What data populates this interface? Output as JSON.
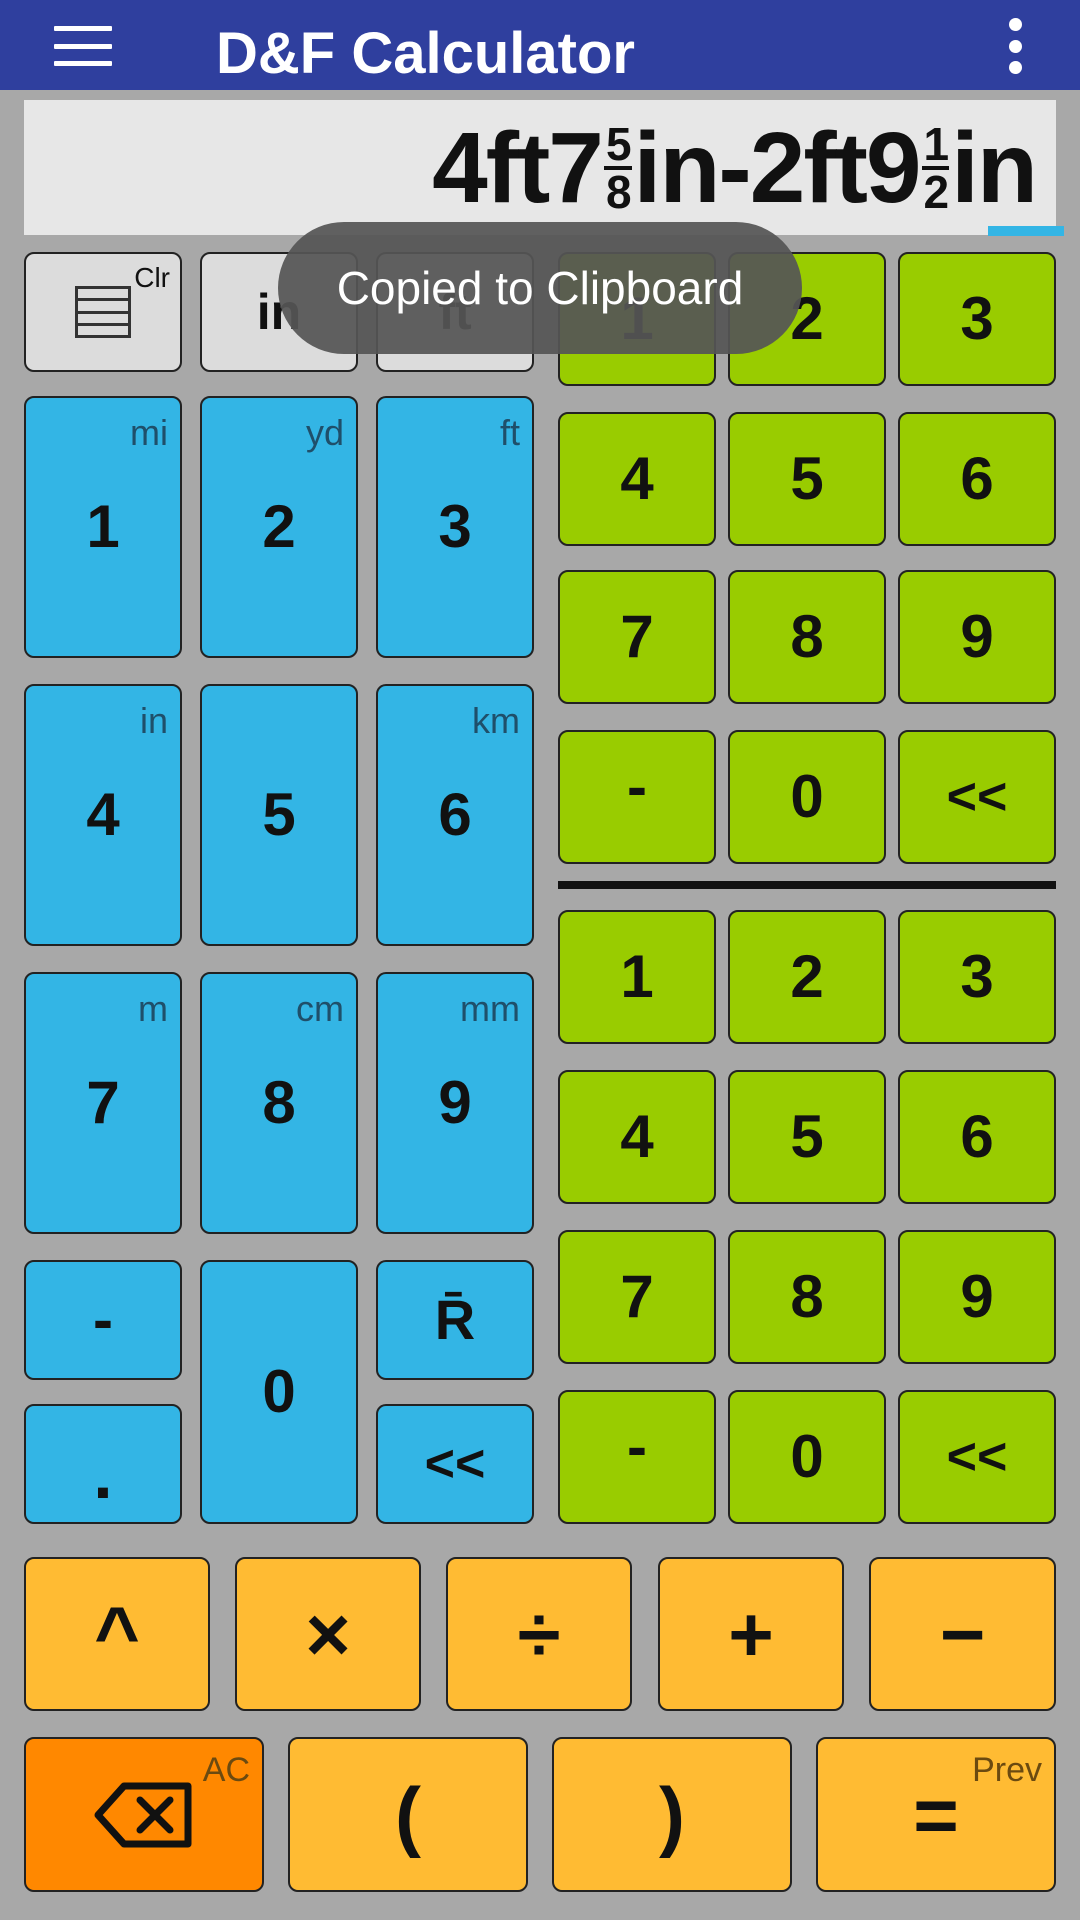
{
  "app": {
    "title": "D&F Calculator"
  },
  "display": {
    "part1_whole": "4ft7",
    "part1_num": "5",
    "part1_den": "8",
    "part1_unit": "in-2ft9",
    "part2_num": "1",
    "part2_den": "2",
    "part2_unit": "in"
  },
  "toast": {
    "message": "Copied to Clipboard"
  },
  "top_row": {
    "clr_label": "Clr",
    "in_label": "in",
    "ft_label": "ft"
  },
  "blue_pad": {
    "keys": [
      {
        "label": "1",
        "sub": "mi"
      },
      {
        "label": "2",
        "sub": "yd"
      },
      {
        "label": "3",
        "sub": "ft"
      },
      {
        "label": "4",
        "sub": "in"
      },
      {
        "label": "5",
        "sub": ""
      },
      {
        "label": "6",
        "sub": "km"
      },
      {
        "label": "7",
        "sub": "m"
      },
      {
        "label": "8",
        "sub": "cm"
      },
      {
        "label": "9",
        "sub": "mm"
      }
    ],
    "minus": "-",
    "dot": ".",
    "zero": "0",
    "recall": "R̄",
    "back": "<<"
  },
  "green_upper": {
    "keys": [
      "1",
      "2",
      "3",
      "4",
      "5",
      "6",
      "7",
      "8",
      "9",
      "-",
      "0",
      "<<"
    ]
  },
  "green_lower": {
    "keys": [
      "1",
      "2",
      "3",
      "4",
      "5",
      "6",
      "7",
      "8",
      "9",
      "-",
      "0",
      "<<"
    ]
  },
  "operators": {
    "power": "^",
    "multiply": "×",
    "divide": "÷",
    "plus": "+",
    "minus": "−"
  },
  "bottom_row": {
    "ac_label": "AC",
    "open_paren": "(",
    "close_paren": ")",
    "equals": "=",
    "prev_label": "Prev"
  },
  "colors": {
    "appbar": "#2f3f9e",
    "blue_key": "#33b5e5",
    "green_key": "#99cc00",
    "orange_key": "#ffbb33",
    "dark_orange_key": "#ff8800",
    "background": "#a8a8a8"
  }
}
